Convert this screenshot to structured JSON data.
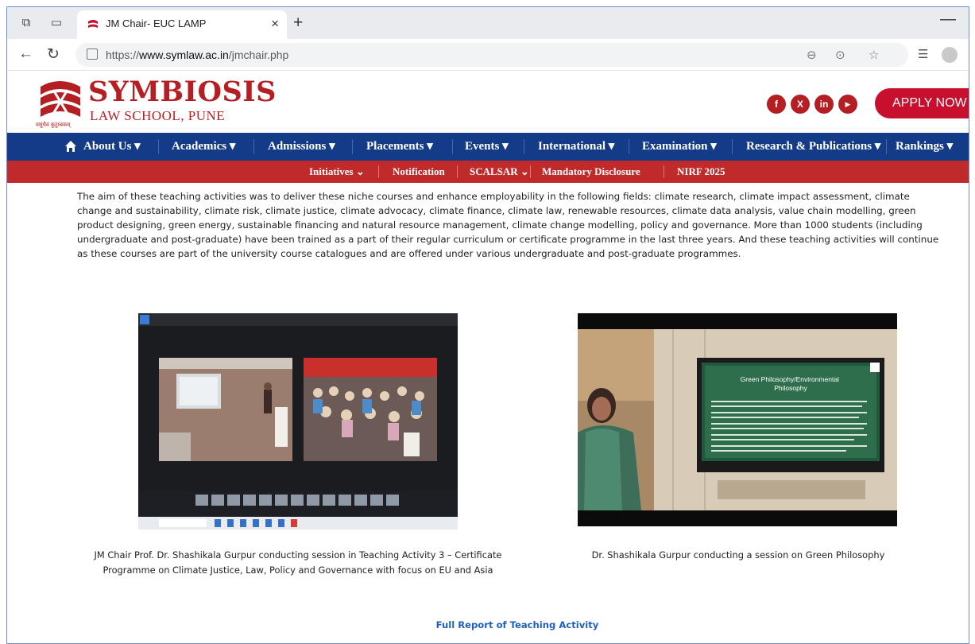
{
  "browser": {
    "tab_title": "JM Chair- EUC LAMP",
    "tab_close": "×",
    "new_tab": "+",
    "url_prefix": "https://",
    "url_domain": "www.symlaw.ac.in",
    "url_path": "/jmchair.php"
  },
  "site": {
    "name": "SYMBIOSIS",
    "subtitle": "LAW SCHOOL, PUNE",
    "motto": "वसुधैव कुटुम्बकम्",
    "apply_label": "APPLY NOW",
    "social": [
      "f",
      "X",
      "in",
      "▶"
    ]
  },
  "main_nav": [
    {
      "label": "About Us ▾"
    },
    {
      "label": "Academics ▾"
    },
    {
      "label": "Admissions ▾"
    },
    {
      "label": "Placements ▾"
    },
    {
      "label": "Events ▾"
    },
    {
      "label": "International ▾"
    },
    {
      "label": "Examination ▾"
    },
    {
      "label": "Research & Publications ▾"
    },
    {
      "label": "Rankings ▾"
    }
  ],
  "sub_nav": [
    {
      "label": "Initiatives ⌄"
    },
    {
      "label": "Notification"
    },
    {
      "label": "SCALSAR ⌄"
    },
    {
      "label": "Mandatory Disclosure"
    },
    {
      "label": "NIRF 2025"
    }
  ],
  "content": {
    "paragraph": "The aim of these teaching activities was to deliver these niche courses and enhance employability in the following fields: climate research, climate impact assessment, climate change and sustainability, climate risk, climate justice, climate advocacy, climate finance, climate law, renewable resources, climate data analysis, value chain modelling, green product designing, green energy, sustainable financing and natural resource management, climate change modelling, policy and governance. More than 1000 students (including undergraduate and post-graduate) have been trained as a part of their regular curriculum or certificate programme in the last three years. And these teaching activities will continue as these courses are part of the university course catalogues and are offered under various undergraduate and post-graduate programmes.",
    "caption_1": "JM Chair Prof. Dr. Shashikala Gurpur conducting session in Teaching Activity 3 – Certificate Programme on Climate Justice, Law, Policy and Governance with focus on EU and Asia",
    "caption_2": "Dr. Shashikala Gurpur conducting a session on Green Philosophy",
    "slide_title": "Green Philosophy/Environmental Philosophy",
    "report_link": "Full Report of Teaching Activity"
  }
}
